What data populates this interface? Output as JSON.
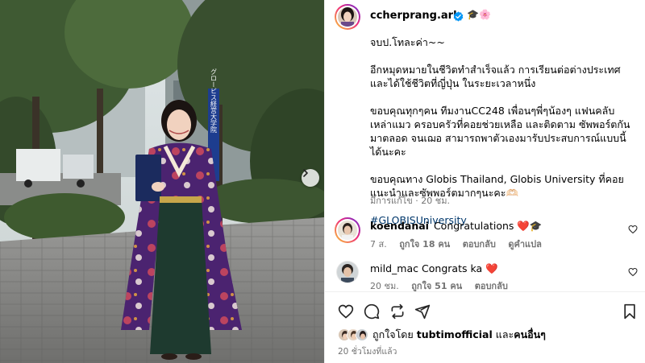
{
  "post": {
    "author": "ccherprang.ark",
    "author_emojis": "🎓🌸",
    "caption": {
      "line1": "จบป.โทละค่า~~",
      "para2": "อีกหมุดหมายในชีวิตทำสำเร็จแล้ว การเรียนต่อต่างประเทศ และได้ใช้ชีวิตที่ญี่ปุ่น ในระยะเวลาหนึ่ง",
      "para3": "ขอบคุณทุกๆคน ทีมงานCC248 เพื่อนๆพี่ๆน้องๆ แฟนคลับ เหล่าแมว ครอบครัวที่คอยช่วยเหลือ และติดตาม ซัพพอร์ตกันมาตลอด จนเฌอ สามารถพาตัวเองมารับประสบการณ์แบบนี้ได้นะคะ",
      "para4": "ขอบคุณทาง Globis Thailand, Globis University ที่คอยแนะนำและซัพพอร์ตมากๆนะคะ🫶🏻",
      "hashtag": "#GLOBISUniversity"
    },
    "edited_label": "มีการแก้ไข · 20 ชม."
  },
  "photo": {
    "sign_text": "グロービス経営大学院"
  },
  "comments": [
    {
      "username": "koendanai",
      "text": "Congratulations ❤️🎓",
      "time": "7 ส.",
      "likes": "ถูกใจ 18 คน",
      "reply": "ตอบกลับ",
      "translate": "ดูคำแปล"
    },
    {
      "username": "mild_mac",
      "text": "Congrats ka ❤️",
      "time": "20 ชม.",
      "likes": "ถูกใจ 51 คน",
      "reply": "ตอบกลับ"
    }
  ],
  "likes_bar": {
    "prefix": "ถูกใจโดย",
    "liker": "tubtimofficial",
    "joiner": "และ",
    "others": "คนอื่นๆ"
  },
  "time_ago": "20 ชั่วโมงที่แล้ว",
  "colors": {
    "verified": "#0095f6",
    "heart": "#ff3040",
    "link": "#00376b",
    "muted": "#737373"
  }
}
